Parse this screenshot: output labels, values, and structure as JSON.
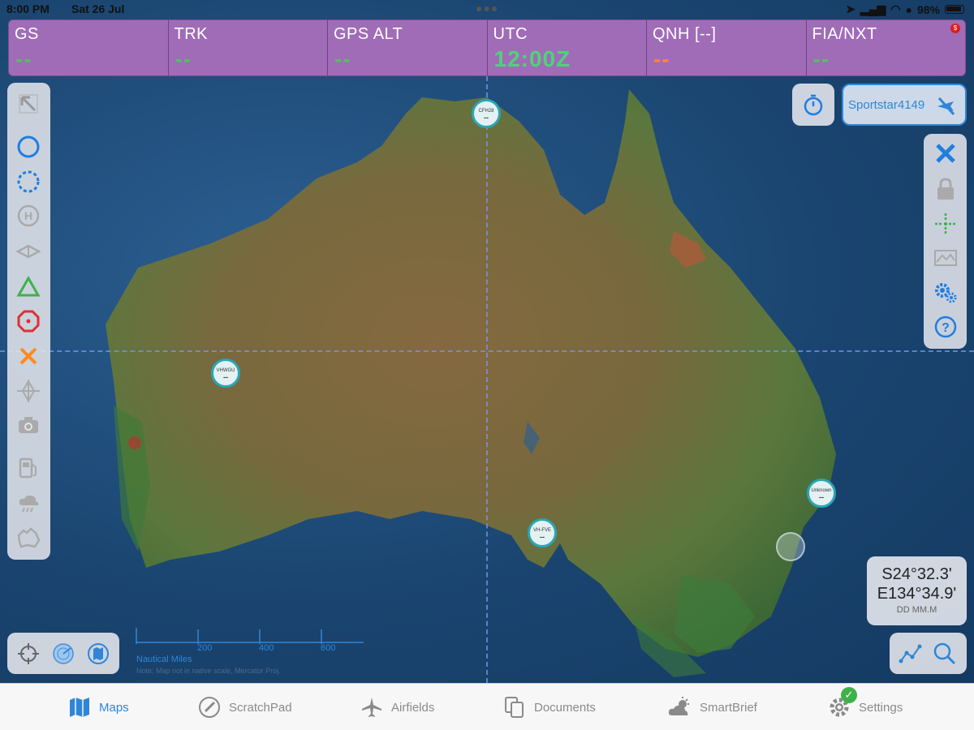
{
  "status_bar": {
    "time": "8:00 PM",
    "date": "Sat 26 Jul",
    "battery": "98%"
  },
  "info_bar": {
    "cells": [
      {
        "label": "GS",
        "value": "--",
        "color": "#55c060"
      },
      {
        "label": "TRK",
        "value": "--",
        "color": "#55c060"
      },
      {
        "label": "GPS ALT",
        "value": "--",
        "color": "#55c060"
      },
      {
        "label": "UTC",
        "value": "12:00Z",
        "color": "#4fd27a"
      },
      {
        "label": "QNH [--]",
        "value": "--",
        "color": "#ff8a1d"
      },
      {
        "label": "FIA/NXT",
        "value": "--",
        "color": "#55c060"
      }
    ],
    "alert_badge": "$",
    "background": "#a06cb8"
  },
  "aircraft_button": {
    "label": "Sportstar4149"
  },
  "left_tools": [
    "expand-arrow-icon",
    "circle-icon",
    "dashed-circle-icon",
    "helipad-icon",
    "diamond-icon",
    "triangle-icon",
    "octagon-icon",
    "cross-icon",
    "crosshair-icon",
    "camera-icon",
    "fuel-pump-icon",
    "storm-cloud-icon",
    "map-outline-icon"
  ],
  "right_tools": [
    "clear-route-icon",
    "lock-icon",
    "centre-crosshair-icon",
    "terrain-icon",
    "settings-gears-icon",
    "help-icon"
  ],
  "map_markers": [
    {
      "code": "CFH28",
      "value": "--"
    },
    {
      "code": "VHWGU",
      "value": "--"
    },
    {
      "code": "VH-FVE",
      "value": "--"
    },
    {
      "code": "Unknown",
      "value": "--"
    }
  ],
  "coordinates": {
    "lat": "S24°32.3'",
    "lon": "E134°34.9'",
    "format": "DD MM.M"
  },
  "scale_bar": {
    "ticks": [
      "200",
      "400",
      "600"
    ],
    "unit": "Nautical Miles",
    "note": "Note: Map not in native scale, Mercator Proj."
  },
  "tab_bar": {
    "tabs": [
      {
        "label": "Maps",
        "icon": "map-icon",
        "active": true
      },
      {
        "label": "ScratchPad",
        "icon": "pencil-circle-icon",
        "active": false
      },
      {
        "label": "Airfields",
        "icon": "plane-icon",
        "active": false
      },
      {
        "label": "Documents",
        "icon": "documents-icon",
        "active": false
      },
      {
        "label": "SmartBrief",
        "icon": "sun-cloud-icon",
        "active": false
      },
      {
        "label": "Settings",
        "icon": "gear-icon",
        "active": false
      }
    ],
    "accent": "#2f86d8"
  }
}
